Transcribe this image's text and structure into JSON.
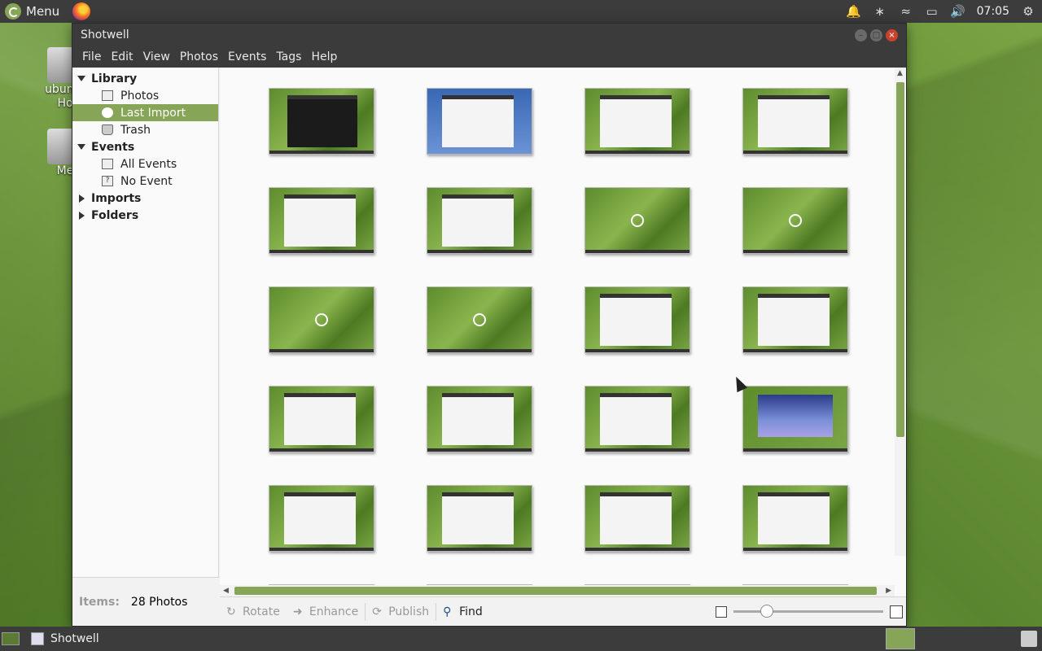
{
  "top_panel": {
    "menu_label": "Menu",
    "clock": "07:05",
    "tray_icons": [
      "bell-icon",
      "bluetooth-icon",
      "wifi-icon",
      "battery-icon",
      "volume-icon",
      "power-icon"
    ]
  },
  "desktop": {
    "icons": [
      {
        "label": "ubuntu\nHo",
        "icon": "home-drive-icon"
      },
      {
        "label": "Me",
        "icon": "media-drive-icon"
      }
    ]
  },
  "window": {
    "title": "Shotwell",
    "menu": [
      "File",
      "Edit",
      "View",
      "Photos",
      "Events",
      "Tags",
      "Help"
    ]
  },
  "sidebar": {
    "library": "Library",
    "photos": "Photos",
    "last_import": "Last Import",
    "trash": "Trash",
    "events": "Events",
    "all_events": "All Events",
    "no_event": "No Event",
    "imports": "Imports",
    "folders": "Folders"
  },
  "status": {
    "items_label": "Items:",
    "items_value": "28 Photos"
  },
  "toolbar": {
    "rotate": "Rotate",
    "enhance": "Enhance",
    "publish": "Publish",
    "find": "Find",
    "zoom_level": 0.18
  },
  "photos": {
    "count": 28,
    "visible": 24
  },
  "taskbar": {
    "task_label": "Shotwell"
  },
  "colors": {
    "accent": "#87a556",
    "panel": "#3c3c3c"
  }
}
